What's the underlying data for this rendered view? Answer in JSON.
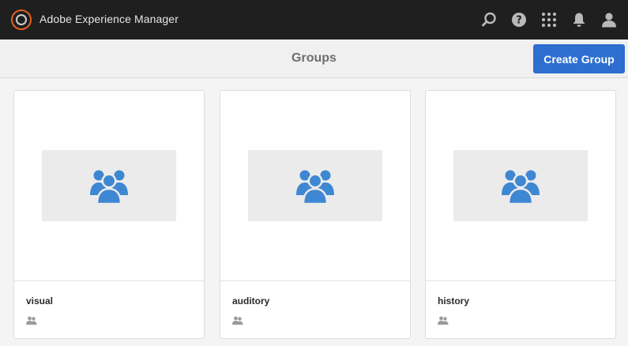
{
  "app": {
    "title": "Adobe Experience Manager",
    "brand_color": "#e65f25"
  },
  "header_icons": [
    {
      "name": "search-icon"
    },
    {
      "name": "help-icon"
    },
    {
      "name": "apps-grid-icon"
    },
    {
      "name": "notifications-bell-icon"
    },
    {
      "name": "user-profile-icon"
    }
  ],
  "page": {
    "title": "Groups",
    "create_button_label": "Create Group",
    "accent_color": "#2d6ed0"
  },
  "groups": [
    {
      "name": "visual",
      "icon": "group-icon"
    },
    {
      "name": "auditory",
      "icon": "group-icon"
    },
    {
      "name": "history",
      "icon": "group-icon"
    }
  ],
  "colors": {
    "group_icon": "#3e87d3",
    "header_bg": "#1f1f1f"
  }
}
